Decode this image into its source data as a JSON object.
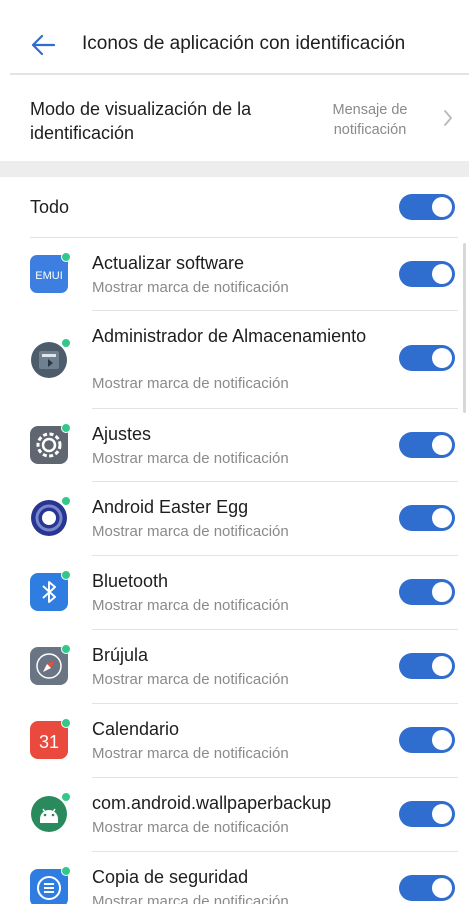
{
  "header": {
    "title": "Iconos de aplicación con identificación",
    "back_icon": "arrow-left-icon",
    "accent": "#2f6ecf"
  },
  "mode": {
    "label": "Modo de visualización de la identificación",
    "value_line1": "Mensaje de",
    "value_line2": "notificación",
    "chevron_icon": "chevron-right-icon"
  },
  "all": {
    "label": "Todo",
    "enabled": true
  },
  "toggle_color": "#2f6ecf",
  "badge_color": "#33c78a",
  "apps": [
    {
      "name": "Actualizar software",
      "subtitle": "Mostrar marca de notificación",
      "icon": "emui-icon",
      "enabled": true
    },
    {
      "name": "Administrador de Almacenamiento",
      "subtitle": "Mostrar marca de notificación",
      "icon": "storage-manager-icon",
      "enabled": true
    },
    {
      "name": "Ajustes",
      "subtitle": "Mostrar marca de notificación",
      "icon": "settings-gear-icon",
      "enabled": true
    },
    {
      "name": "Android Easter Egg",
      "subtitle": "Mostrar marca de notificación",
      "icon": "easter-egg-icon",
      "enabled": true
    },
    {
      "name": "Bluetooth",
      "subtitle": "Mostrar marca de notificación",
      "icon": "bluetooth-icon",
      "enabled": true
    },
    {
      "name": "Brújula",
      "subtitle": "Mostrar marca de notificación",
      "icon": "compass-icon",
      "enabled": true
    },
    {
      "name": "Calendario",
      "subtitle": "Mostrar marca de notificación",
      "icon": "calendar-icon",
      "calendar_day": "31",
      "enabled": true
    },
    {
      "name": "com.android.wallpaperbackup",
      "subtitle": "Mostrar marca de notificación",
      "icon": "android-robot-icon",
      "enabled": true
    },
    {
      "name": "Copia de seguridad",
      "subtitle": "Mostrar marca de notificación",
      "icon": "backup-icon",
      "enabled": true
    }
  ]
}
